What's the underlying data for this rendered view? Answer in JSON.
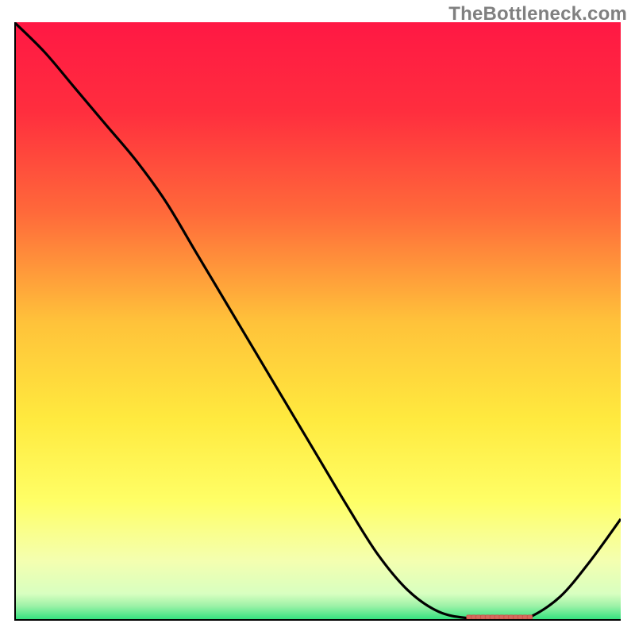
{
  "watermark": "TheBottleneck.com",
  "colors": {
    "axis": "#000000",
    "curve": "#000000",
    "watermark": "#808080",
    "marker_fill": "#d46a5f",
    "marker_stroke": "#c94f44",
    "gradient_top": "#ff1844",
    "gradient_upper_mid": "#ff9a3a",
    "gradient_mid": "#ffe93e",
    "gradient_lower": "#ffff9a",
    "gradient_pale": "#f2ffd6",
    "gradient_green": "#29e07a"
  },
  "chart_data": {
    "type": "line",
    "title": "",
    "xlabel": "",
    "ylabel": "",
    "xlim": [
      0,
      100
    ],
    "ylim": [
      0,
      100
    ],
    "x": [
      0,
      5,
      10,
      15,
      20,
      25,
      30,
      35,
      40,
      45,
      50,
      55,
      60,
      65,
      70,
      75,
      80,
      82,
      85,
      90,
      95,
      100
    ],
    "y": [
      100,
      95,
      89,
      83,
      77,
      70,
      61.5,
      53,
      44.5,
      36,
      27.5,
      19,
      11,
      5,
      1.5,
      0.4,
      0.2,
      0.2,
      0.6,
      4,
      10,
      17
    ],
    "marker_band_x": [
      75,
      85
    ],
    "marker_band_y": 0.6,
    "gradient_stops": [
      {
        "pos": 0.0,
        "color": "#ff1844"
      },
      {
        "pos": 0.15,
        "color": "#ff2e3e"
      },
      {
        "pos": 0.32,
        "color": "#ff6a3a"
      },
      {
        "pos": 0.5,
        "color": "#ffc23a"
      },
      {
        "pos": 0.66,
        "color": "#ffe93e"
      },
      {
        "pos": 0.8,
        "color": "#ffff66"
      },
      {
        "pos": 0.9,
        "color": "#f4ffb0"
      },
      {
        "pos": 0.955,
        "color": "#d8ffc0"
      },
      {
        "pos": 0.975,
        "color": "#9ef2a8"
      },
      {
        "pos": 1.0,
        "color": "#29e07a"
      }
    ]
  }
}
